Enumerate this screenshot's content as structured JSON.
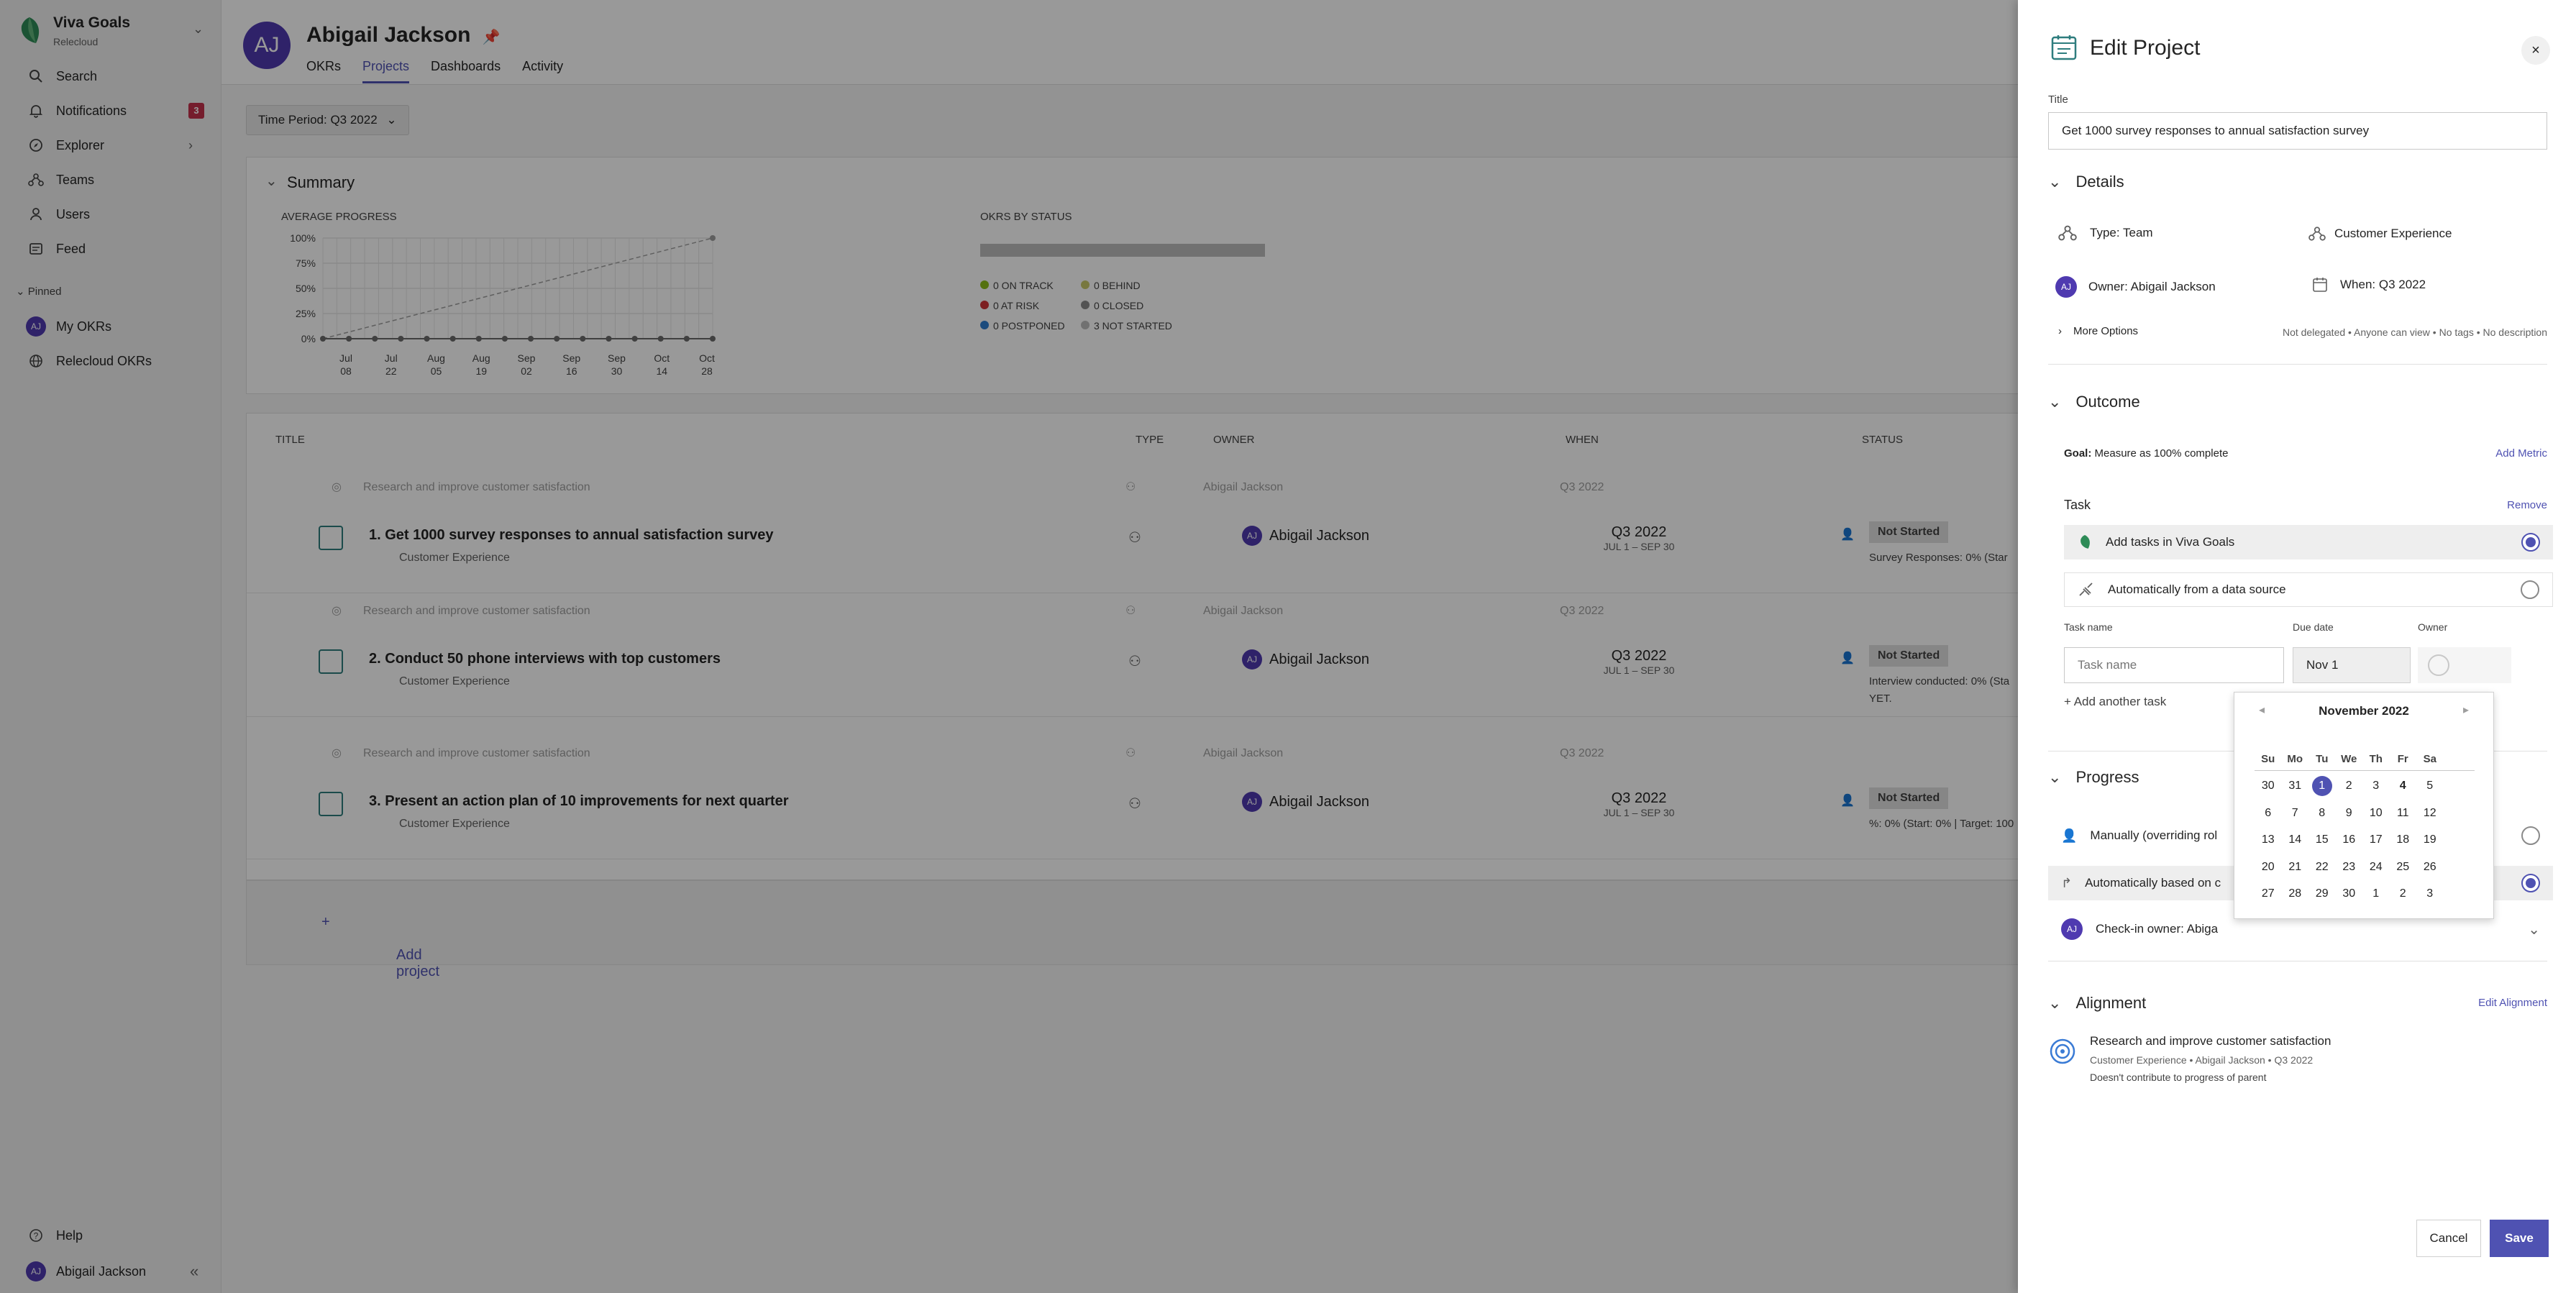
{
  "sidebar": {
    "brand_name": "Viva Goals",
    "brand_sub": "Relecloud",
    "items": [
      {
        "label": "Search",
        "icon": "search-icon"
      },
      {
        "label": "Notifications",
        "icon": "bell-icon",
        "badge": "3"
      },
      {
        "label": "Explorer",
        "icon": "compass-icon"
      },
      {
        "label": "Teams",
        "icon": "teams-icon"
      },
      {
        "label": "Users",
        "icon": "users-icon"
      },
      {
        "label": "Feed",
        "icon": "feed-icon"
      }
    ],
    "pinned_label": "Pinned",
    "pinned": [
      {
        "label": "My OKRs",
        "avatar": "AJ"
      },
      {
        "label": "Relecloud OKRs",
        "icon": "globe-icon"
      }
    ],
    "help_label": "Help",
    "user_name": "Abigail Jackson",
    "user_initials": "AJ"
  },
  "header": {
    "initials": "AJ",
    "name": "Abigail Jackson",
    "tabs": [
      "OKRs",
      "Projects",
      "Dashboards",
      "Activity"
    ],
    "active_tab": "Projects"
  },
  "time_period": "Time Period: Q3 2022",
  "summary": {
    "title": "Summary",
    "avg_progress_label": "AVERAGE PROGRESS",
    "okrs_by_status_label": "OKRS BY STATUS",
    "status_legend": [
      {
        "label": "0 ON TRACK",
        "color": "#8cbd18"
      },
      {
        "label": "0 BEHIND",
        "color": "#c8c86a"
      },
      {
        "label": "0 AT RISK",
        "color": "#d13438"
      },
      {
        "label": "0 CLOSED",
        "color": "#8a8a8a"
      },
      {
        "label": "0 POSTPONED",
        "color": "#2e7dd1"
      },
      {
        "label": "3 NOT STARTED",
        "color": "#bdbdbd"
      }
    ]
  },
  "chart_data": {
    "type": "line",
    "title": "AVERAGE PROGRESS",
    "categories": [
      "Jul 08",
      "Jul 22",
      "Aug 05",
      "Aug 19",
      "Sep 02",
      "Sep 16",
      "Sep 30",
      "Oct 14",
      "Oct 28"
    ],
    "yticks": [
      "100%",
      "75%",
      "50%",
      "25%",
      "0%"
    ],
    "ylim": [
      0,
      100
    ],
    "series": [
      {
        "values": [
          0,
          0,
          0,
          0,
          0,
          0,
          0,
          0,
          0,
          0,
          0,
          0,
          0,
          0,
          0,
          0
        ]
      }
    ],
    "target_line": {
      "from": 0,
      "to": 100
    },
    "grid": true
  },
  "table": {
    "headers": {
      "title": "TITLE",
      "type": "TYPE",
      "owner": "OWNER",
      "when": "WHEN",
      "status": "STATUS"
    },
    "rows": [
      {
        "parent": "Research and improve customer satisfaction",
        "parent_owner": "Abigail Jackson",
        "parent_when": "Q3 2022",
        "number": "1.",
        "title": "Get 1000 survey responses to annual satisfaction survey",
        "team": "Customer Experience",
        "owner": "Abigail Jackson",
        "when": "Q3 2022",
        "range": "JUL 1 – SEP 30",
        "status": "Not Started",
        "note": "Survey Responses: 0% (Star"
      },
      {
        "parent": "Research and improve customer satisfaction",
        "parent_owner": "Abigail Jackson",
        "parent_when": "Q3 2022",
        "number": "2.",
        "title": "Conduct 50 phone interviews with top customers",
        "team": "Customer Experience",
        "owner": "Abigail Jackson",
        "when": "Q3 2022",
        "range": "JUL 1 – SEP 30",
        "status": "Not Started",
        "note": "Interview conducted: 0% (Sta",
        "note2": "YET."
      },
      {
        "parent": "Research and improve customer satisfaction",
        "parent_owner": "Abigail Jackson",
        "parent_when": "Q3 2022",
        "number": "3.",
        "title": "Present an action plan of 10 improvements for next quarter",
        "team": "Customer Experience",
        "owner": "Abigail Jackson",
        "when": "Q3 2022",
        "range": "JUL 1 – SEP 30",
        "status": "Not Started",
        "note": "%: 0% (Start: 0% | Target: 100"
      }
    ],
    "add_project": "Add project"
  },
  "panel": {
    "title": "Edit Project",
    "title_label": "Title",
    "title_value": "Get 1000 survey responses to annual satisfaction survey",
    "details": {
      "heading": "Details",
      "type": "Type: Team",
      "team": "Customer Experience",
      "owner": "Owner: Abigail Jackson",
      "owner_initials": "AJ",
      "when": "When: Q3 2022",
      "more_options": "More Options",
      "more_summary": "Not delegated • Anyone can view • No tags • No description"
    },
    "outcome": {
      "heading": "Outcome",
      "goal_label": "Goal:",
      "goal_value": "Measure as 100% complete",
      "add_metric": "Add Metric",
      "task_label": "Task",
      "remove": "Remove",
      "option_viva": "Add tasks in Viva Goals",
      "option_source": "Automatically from a data source",
      "col_task": "Task name",
      "col_due": "Due date",
      "col_owner": "Owner",
      "task_placeholder": "Task name",
      "due_value": "Nov 1",
      "add_another": "+ Add another task"
    },
    "progress": {
      "heading": "Progress",
      "manual": "Manually (overriding rol",
      "auto": "Automatically based on c",
      "checkin": "Check-in owner: Abiga",
      "checkin_initials": "AJ"
    },
    "alignment": {
      "heading": "Alignment",
      "edit": "Edit Alignment",
      "parent_title": "Research and improve customer satisfaction",
      "parent_meta": "Customer Experience • Abigail Jackson • Q3 2022",
      "parent_note": "Doesn't contribute to progress of parent"
    },
    "cancel": "Cancel",
    "save": "Save"
  },
  "calendar": {
    "month": "November 2022",
    "dow": [
      "Su",
      "Mo",
      "Tu",
      "We",
      "Th",
      "Fr",
      "Sa"
    ],
    "weeks": [
      [
        "30",
        "31",
        "1",
        "2",
        "3",
        "4",
        "5"
      ],
      [
        "6",
        "7",
        "8",
        "9",
        "10",
        "11",
        "12"
      ],
      [
        "13",
        "14",
        "15",
        "16",
        "17",
        "18",
        "19"
      ],
      [
        "20",
        "21",
        "22",
        "23",
        "24",
        "25",
        "26"
      ],
      [
        "27",
        "28",
        "29",
        "30",
        "1",
        "2",
        "3"
      ]
    ],
    "selected": "1",
    "today": "4"
  },
  "colors": {
    "accent": "#4f52b2",
    "avatar": "#4f3ab0",
    "badge": "#c4314b"
  }
}
